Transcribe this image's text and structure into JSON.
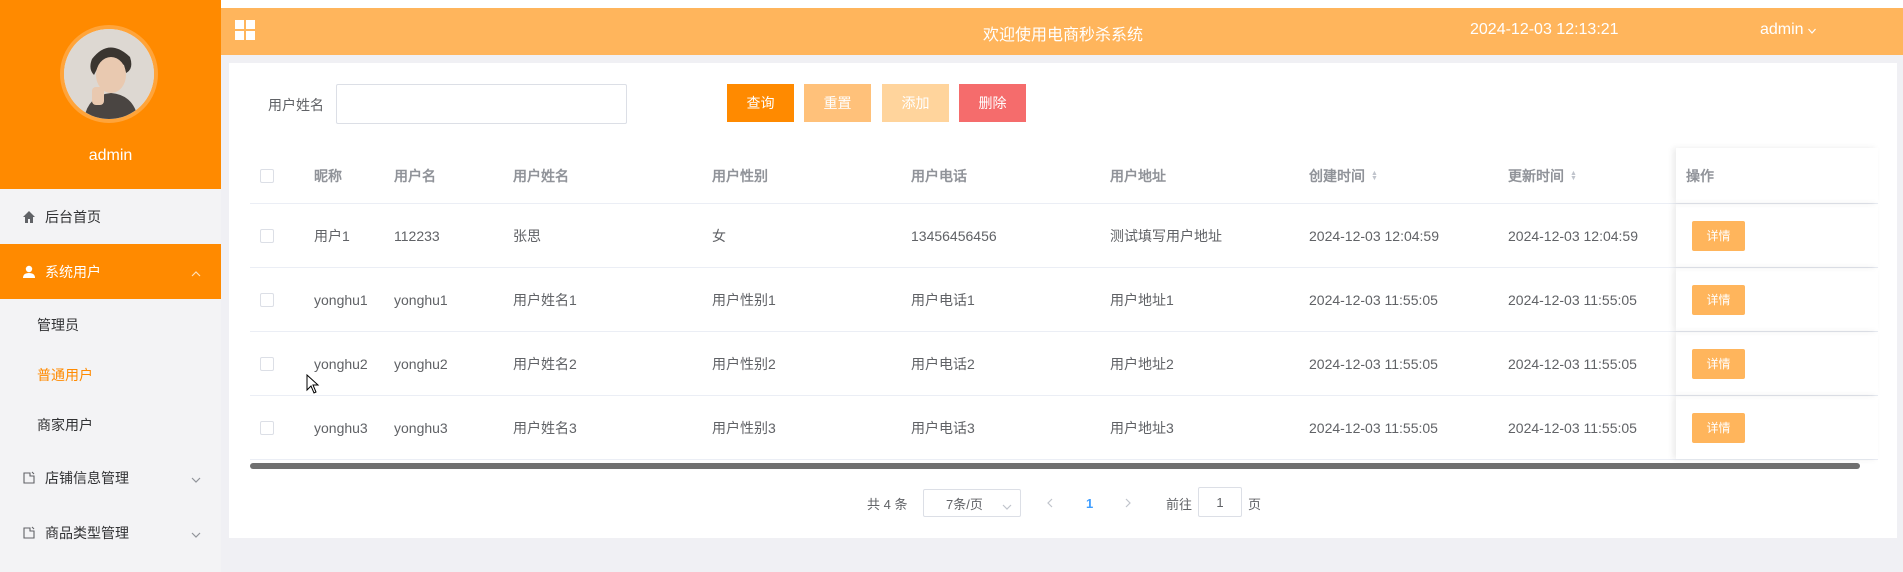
{
  "sidebar": {
    "user_name": "admin",
    "menu": [
      {
        "label": "后台首页",
        "icon": "home-icon"
      },
      {
        "label": "系统用户",
        "icon": "user-icon",
        "active": true
      },
      {
        "label": "店铺信息管理",
        "icon": "folder-icon"
      },
      {
        "label": "商品类型管理",
        "icon": "folder-icon"
      }
    ],
    "submenu": [
      {
        "label": "管理员"
      },
      {
        "label": "普通用户",
        "current": true
      },
      {
        "label": "商家用户"
      }
    ]
  },
  "topbar": {
    "title": "欢迎使用电商秒杀系统",
    "datetime": "2024-12-03 12:13:21",
    "user": "admin"
  },
  "search": {
    "label": "用户姓名",
    "value": "",
    "placeholder": ""
  },
  "buttons": {
    "query": "查询",
    "reset": "重置",
    "add": "添加",
    "delete": "删除"
  },
  "table": {
    "headers": [
      "昵称",
      "用户名",
      "用户姓名",
      "用户性别",
      "用户电话",
      "用户地址",
      "创建时间",
      "更新时间",
      "操作"
    ],
    "rows": [
      {
        "nickname": "用户1",
        "username": "112233",
        "realname": "张思",
        "gender": "女",
        "phone": "13456456456",
        "address": "测试填写用户地址",
        "created": "2024-12-03 12:04:59",
        "updated": "2024-12-03 12:04:59",
        "action": "详情"
      },
      {
        "nickname": "yonghu1",
        "username": "yonghu1",
        "realname": "用户姓名1",
        "gender": "用户性别1",
        "phone": "用户电话1",
        "address": "用户地址1",
        "created": "2024-12-03 11:55:05",
        "updated": "2024-12-03 11:55:05",
        "action": "详情"
      },
      {
        "nickname": "yonghu2",
        "username": "yonghu2",
        "realname": "用户姓名2",
        "gender": "用户性别2",
        "phone": "用户电话2",
        "address": "用户地址2",
        "created": "2024-12-03 11:55:05",
        "updated": "2024-12-03 11:55:05",
        "action": "详情"
      },
      {
        "nickname": "yonghu3",
        "username": "yonghu3",
        "realname": "用户姓名3",
        "gender": "用户性别3",
        "phone": "用户电话3",
        "address": "用户地址3",
        "created": "2024-12-03 11:55:05",
        "updated": "2024-12-03 11:55:05",
        "action": "详情"
      }
    ]
  },
  "pagination": {
    "total": "共 4 条",
    "page_size": "7条/页",
    "current_page": "1",
    "goto_label": "前往",
    "goto_value": "1",
    "unit": "页"
  },
  "colors": {
    "primary": "#ff8a00",
    "topbar": "#ffb55c",
    "danger": "#f56c6c",
    "link": "#409eff"
  }
}
